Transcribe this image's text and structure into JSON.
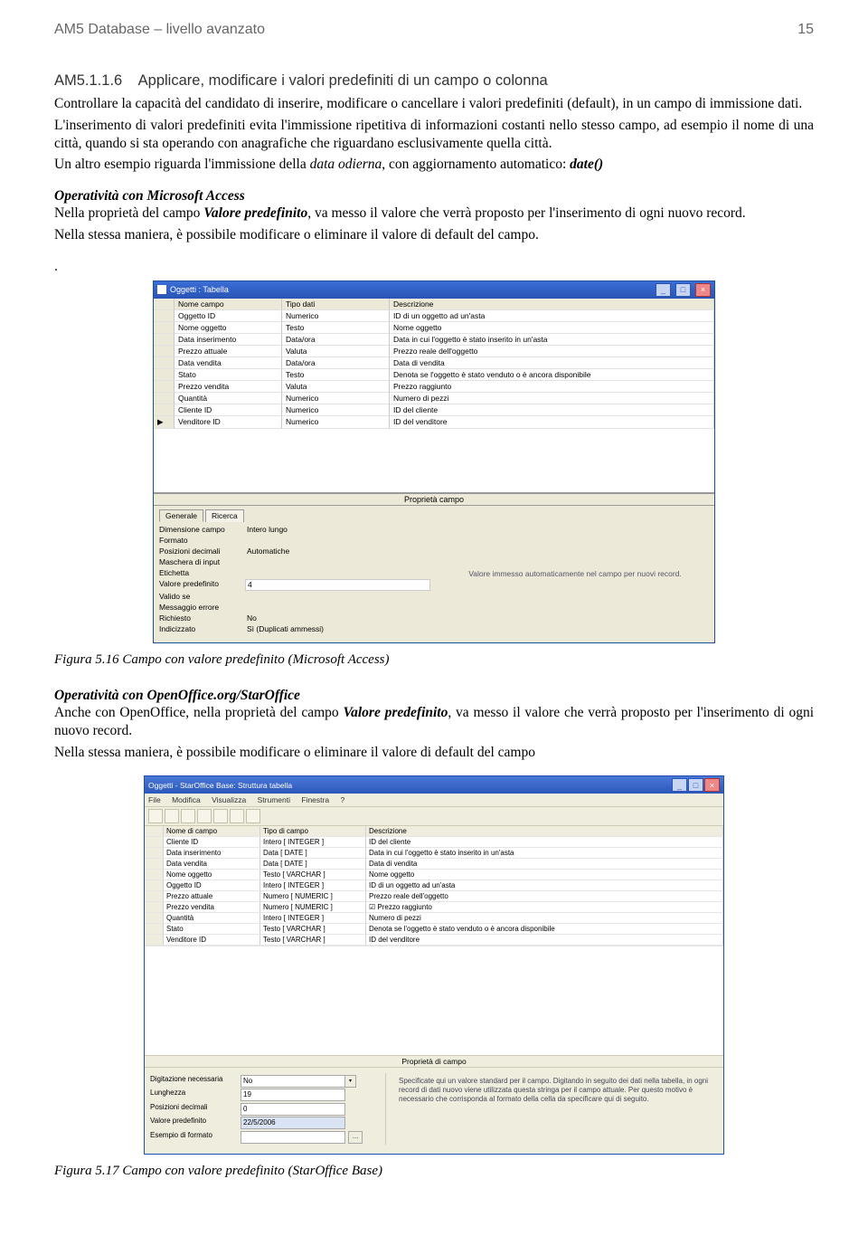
{
  "header": {
    "left": "AM5 Database – livello avanzato",
    "page": "15"
  },
  "section": {
    "number": "AM5.1.1.6",
    "title": "Applicare, modificare i valori predefiniti di un campo o colonna"
  },
  "para1": "Controllare la capacità del candidato di inserire, modificare o cancellare i valori predefiniti (default), in un campo di immissione dati.",
  "para2": "L'inserimento di valori predefiniti evita l'immissione ripetitiva di informazioni costanti nello stesso campo, ad esempio il nome di una città, quando si sta operando con anagrafiche che riguardano esclusivamente quella città.",
  "para3_a": "Un altro esempio riguarda l'immissione della ",
  "para3_i": "data odierna",
  "para3_b": ", con aggiornamento automatico: ",
  "para3_code": "date()",
  "opAccess": {
    "heading": "Operatività con Microsoft Access",
    "line1_a": "Nella proprietà del campo ",
    "line1_b": "Valore predefinito",
    "line1_c": ", va messo il valore che verrà proposto per l'inserimento di ogni nuovo record.",
    "line2": "Nella stessa maniera, è possibile modificare o eliminare il valore di default del campo."
  },
  "caption1": "Figura 5.16 Campo con valore predefinito (Microsoft Access)",
  "opOO": {
    "heading": "Operatività con OpenOffice.org/StarOffice",
    "line1_a": "Anche con OpenOffice, nella proprietà del campo ",
    "line1_b": "Valore predefinito",
    "line1_c": ", va messo il valore che verrà proposto per l'inserimento di ogni nuovo record.",
    "line2": "Nella stessa maniera, è possibile modificare o eliminare il valore di default del campo"
  },
  "caption2": "Figura 5.17 Campo con valore predefinito (StarOffice Base)",
  "access": {
    "title": "Oggetti : Tabella",
    "head": {
      "c1": "Nome campo",
      "c2": "Tipo dati",
      "c3": "Descrizione"
    },
    "rows": [
      {
        "sel": "",
        "c1": "Oggetto ID",
        "c2": "Numerico",
        "c3": "ID di un oggetto ad un'asta"
      },
      {
        "sel": "",
        "c1": "Nome oggetto",
        "c2": "Testo",
        "c3": "Nome oggetto"
      },
      {
        "sel": "",
        "c1": "Data inserimento",
        "c2": "Data/ora",
        "c3": "Data in cui l'oggetto è stato inserito in un'asta"
      },
      {
        "sel": "",
        "c1": "Prezzo attuale",
        "c2": "Valuta",
        "c3": "Prezzo reale dell'oggetto"
      },
      {
        "sel": "",
        "c1": "Data vendita",
        "c2": "Data/ora",
        "c3": "Data di vendita"
      },
      {
        "sel": "",
        "c1": "Stato",
        "c2": "Testo",
        "c3": "Denota se l'oggetto è stato venduto o è ancora disponibile"
      },
      {
        "sel": "",
        "c1": "Prezzo vendita",
        "c2": "Valuta",
        "c3": "Prezzo raggiunto"
      },
      {
        "sel": "",
        "c1": "Quantità",
        "c2": "Numerico",
        "c3": "Numero di pezzi"
      },
      {
        "sel": "",
        "c1": "Cliente ID",
        "c2": "Numerico",
        "c3": "ID del cliente"
      },
      {
        "sel": "▶",
        "c1": "Venditore ID",
        "c2": "Numerico",
        "c3": "ID del venditore"
      }
    ],
    "propbar": "Proprietà campo",
    "tabs": {
      "general": "Generale",
      "lookup": "Ricerca"
    },
    "props": {
      "dimensione": {
        "lbl": "Dimensione campo",
        "val": "Intero lungo"
      },
      "formato": {
        "lbl": "Formato",
        "val": ""
      },
      "posizioni": {
        "lbl": "Posizioni decimali",
        "val": "Automatiche"
      },
      "maschera": {
        "lbl": "Maschera di input",
        "val": ""
      },
      "etichetta": {
        "lbl": "Etichetta",
        "val": ""
      },
      "valorePred": {
        "lbl": "Valore predefinito",
        "val": "4"
      },
      "valido": {
        "lbl": "Valido se",
        "val": ""
      },
      "msgErrore": {
        "lbl": "Messaggio errore",
        "val": ""
      },
      "richiesto": {
        "lbl": "Richiesto",
        "val": "No"
      },
      "indicizzato": {
        "lbl": "Indicizzato",
        "val": "Sì (Duplicati ammessi)"
      }
    },
    "helpText": "Valore immesso automaticamente nel campo per nuovi record."
  },
  "so": {
    "title": "Oggetti - StarOffice Base: Struttura tabella",
    "menu": {
      "m1": "File",
      "m2": "Modifica",
      "m3": "Visualizza",
      "m4": "Strumenti",
      "m5": "Finestra",
      "m6": "?"
    },
    "head": {
      "c1": "Nome di campo",
      "c2": "Tipo di campo",
      "c3": "Descrizione"
    },
    "rows": [
      {
        "c1": "Cliente ID",
        "c2": "Intero [ INTEGER ]",
        "c3": "ID del cliente"
      },
      {
        "c1": "Data inserimento",
        "c2": "Data [ DATE ]",
        "c3": "Data in cui l'oggetto è stato inserito in un'asta"
      },
      {
        "c1": "Data vendita",
        "c2": "Data [ DATE ]",
        "c3": "Data di vendita"
      },
      {
        "c1": "Nome oggetto",
        "c2": "Testo [ VARCHAR ]",
        "c3": "Nome oggetto"
      },
      {
        "c1": "Oggetto ID",
        "c2": "Intero [ INTEGER ]",
        "c3": "ID di un oggetto ad un'asta"
      },
      {
        "c1": "Prezzo attuale",
        "c2": "Numero [ NUMERIC ]",
        "c3": "Prezzo reale dell'oggetto"
      },
      {
        "c1": "Prezzo vendita",
        "c2": "Numero [ NUMERIC ]",
        "c3": "Prezzo raggiunto",
        "chk": true
      },
      {
        "c1": "Quantità",
        "c2": "Intero [ INTEGER ]",
        "c3": "Numero di pezzi"
      },
      {
        "c1": "Stato",
        "c2": "Testo [ VARCHAR ]",
        "c3": "Denota se l'oggetto è stato venduto o è ancora disponibile"
      },
      {
        "c1": "Venditore ID",
        "c2": "Testo [ VARCHAR ]",
        "c3": "ID del venditore"
      }
    ],
    "propbar": "Proprietà di campo",
    "props": {
      "digitazione": {
        "lbl": "Digitazione necessaria",
        "val": "No"
      },
      "lunghezza": {
        "lbl": "Lunghezza",
        "val": "19"
      },
      "posizioni": {
        "lbl": "Posizioni decimali",
        "val": "0"
      },
      "valorePred": {
        "lbl": "Valore predefinito",
        "val": "22/5/2006"
      },
      "esempio": {
        "lbl": "Esempio di formato",
        "val": ""
      }
    },
    "helpText": "Specificate qui un valore standard per il campo.\n\nDigitando in seguito dei dati nella tabella, in ogni record di dati nuovo viene utilizzata questa stringa per il campo attuale. Per questo motivo è necessario che corrisponda al formato della cella da specificare qui di seguito."
  }
}
